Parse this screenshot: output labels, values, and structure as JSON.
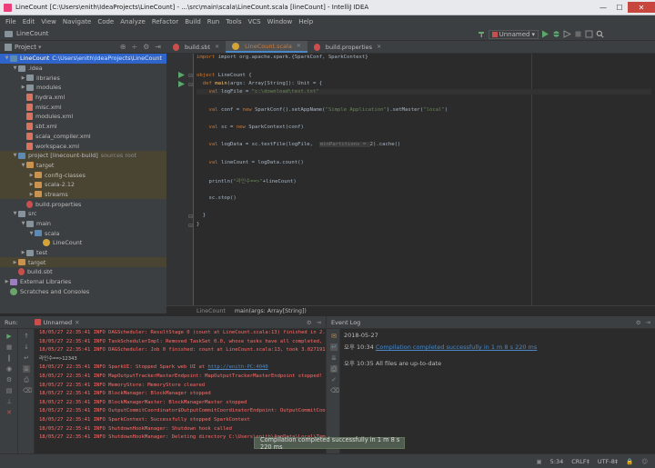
{
  "window": {
    "title": "LineCount [C:\\Users\\enith\\IdeaProjects\\LineCount] - ...\\src\\main\\scala\\LineCount.scala [lineCount] - IntelliJ IDEA",
    "min_glyph": "—",
    "max_glyph": "☐",
    "close_glyph": "✕"
  },
  "menu": [
    "File",
    "Edit",
    "View",
    "Navigate",
    "Code",
    "Analyze",
    "Refactor",
    "Build",
    "Run",
    "Tools",
    "VCS",
    "Window",
    "Help"
  ],
  "navbar": {
    "project_name": "LineCount",
    "run_config": "Unnamed"
  },
  "project_panel": {
    "title": "Project",
    "tree": [
      {
        "label": "LineCount",
        "extra": "C:\\Users\\enith\\IdeaProjects\\LineCount",
        "depth": 0,
        "arrow": "▼",
        "icon": "folder blue",
        "state": "sel"
      },
      {
        "label": ".idea",
        "extra": "",
        "depth": 1,
        "arrow": "▼",
        "icon": "folder",
        "state": ""
      },
      {
        "label": "libraries",
        "extra": "",
        "depth": 2,
        "arrow": "▶",
        "icon": "folder",
        "state": ""
      },
      {
        "label": "modules",
        "extra": "",
        "depth": 2,
        "arrow": "▶",
        "icon": "folder",
        "state": ""
      },
      {
        "label": "hydra.xml",
        "extra": "",
        "depth": 2,
        "arrow": "",
        "icon": "xmlicon",
        "state": ""
      },
      {
        "label": "misc.xml",
        "extra": "",
        "depth": 2,
        "arrow": "",
        "icon": "xmlicon",
        "state": ""
      },
      {
        "label": "modules.xml",
        "extra": "",
        "depth": 2,
        "arrow": "",
        "icon": "xmlicon",
        "state": ""
      },
      {
        "label": "sbt.xml",
        "extra": "",
        "depth": 2,
        "arrow": "",
        "icon": "xmlicon",
        "state": ""
      },
      {
        "label": "scala_compiler.xml",
        "extra": "",
        "depth": 2,
        "arrow": "",
        "icon": "xmlicon",
        "state": ""
      },
      {
        "label": "workspace.xml",
        "extra": "",
        "depth": 2,
        "arrow": "",
        "icon": "xmlicon",
        "state": ""
      },
      {
        "label": "project [linecount-build]",
        "extra": "sources root",
        "depth": 1,
        "arrow": "▼",
        "icon": "folder blue",
        "state": "hl"
      },
      {
        "label": "target",
        "extra": "",
        "depth": 2,
        "arrow": "▼",
        "icon": "folder orange",
        "state": "hl"
      },
      {
        "label": "config-classes",
        "extra": "",
        "depth": 3,
        "arrow": "▶",
        "icon": "folder orange",
        "state": "hl"
      },
      {
        "label": "scala-2.12",
        "extra": "",
        "depth": 3,
        "arrow": "▶",
        "icon": "folder orange",
        "state": "hl"
      },
      {
        "label": "streams",
        "extra": "",
        "depth": 3,
        "arrow": "▶",
        "icon": "folder orange",
        "state": "hl"
      },
      {
        "label": "build.properties",
        "extra": "",
        "depth": 2,
        "arrow": "",
        "icon": "sbticon",
        "state": ""
      },
      {
        "label": "src",
        "extra": "",
        "depth": 1,
        "arrow": "▼",
        "icon": "folder",
        "state": ""
      },
      {
        "label": "main",
        "extra": "",
        "depth": 2,
        "arrow": "▼",
        "icon": "folder",
        "state": ""
      },
      {
        "label": "scala",
        "extra": "",
        "depth": 3,
        "arrow": "▼",
        "icon": "folder blue",
        "state": ""
      },
      {
        "label": "LineCount",
        "extra": "",
        "depth": 4,
        "arrow": "",
        "icon": "scalaicon",
        "state": ""
      },
      {
        "label": "test",
        "extra": "",
        "depth": 2,
        "arrow": "▶",
        "icon": "folder",
        "state": ""
      },
      {
        "label": "target",
        "extra": "",
        "depth": 1,
        "arrow": "▶",
        "icon": "folder orange",
        "state": "hl"
      },
      {
        "label": "build.sbt",
        "extra": "",
        "depth": 1,
        "arrow": "",
        "icon": "sbticon",
        "state": ""
      },
      {
        "label": "External Libraries",
        "extra": "",
        "depth": 0,
        "arrow": "▶",
        "icon": "libicon",
        "state": ""
      },
      {
        "label": "Scratches and Consoles",
        "extra": "",
        "depth": 0,
        "arrow": "",
        "icon": "scratch",
        "state": ""
      }
    ]
  },
  "tabs": [
    {
      "label": "build.sbt",
      "active": false
    },
    {
      "label": "LineCount.scala",
      "active": true
    },
    {
      "label": "build.properties",
      "active": false
    }
  ],
  "code": {
    "l1": "import org.apache.spark.{SparkConf, SparkContext}",
    "l3a": "object ",
    "l3b": "LineCount {",
    "l4a": "  def ",
    "l4b": "main",
    "l4c": "(args: Array[String]): Unit = {",
    "l5a": "    val ",
    "l5b": "logFile = ",
    "l5c": "\"c:\\download\\test.txt\"",
    "l7a": "    val ",
    "l7b": "conf = ",
    "l7c": "new ",
    "l7d": "SparkConf().setAppName(",
    "l7e": "\"Simple Application\"",
    "l7f": ").setMaster(",
    "l7g": "\"local\"",
    "l7h": ")",
    "l9a": "    val ",
    "l9b": "sc = ",
    "l9c": "new ",
    "l9d": "SparkContext(conf)",
    "l11a": "    val ",
    "l11b": "logData = sc.textFile(logFile,  ",
    "l11c": "minPartitions = ",
    "l11d": "2).cache()",
    "l13a": "    val ",
    "l13b": "lineCount = logData.count()",
    "l15a": "    println(",
    "l15b": "\"라인수==>\"",
    "l15c": "+lineCount)",
    "l17": "    sc.stop()",
    "l19": "  }",
    "l20": "}"
  },
  "breadcrumb": {
    "object": "LineCount",
    "method": "main(args: Array[String])"
  },
  "run_panel": {
    "title": "Run:",
    "tab": "Unnamed",
    "lines": [
      {
        "text": "18/05/27 22:35:41 INFO DAGScheduler: ResultStage 0 (count at LineCount.scala:13) finished in 2.814 s",
        "kind": "err"
      },
      {
        "text": "18/05/27 22:35:41 INFO TaskSchedulerImpl: Removed TaskSet 0.0, whose tasks have all completed, from pool",
        "kind": "err"
      },
      {
        "text": "18/05/27 22:35:41 INFO DAGScheduler: Job 0 finished: count at LineCount.scala:13, took 3.027191 s",
        "kind": "err"
      },
      {
        "text": "라인수==>12343",
        "kind": "norm"
      },
      {
        "text_pre": "18/05/27 22:35:41 INFO SparkUI: Stopped Spark web UI at ",
        "link": "http://enith-PC:4040",
        "kind": "link"
      },
      {
        "text": "18/05/27 22:35:41 INFO MapOutputTrackerMasterEndpoint: MapOutputTrackerMasterEndpoint stopped!",
        "kind": "err"
      },
      {
        "text": "18/05/27 22:35:41 INFO MemoryStore: MemoryStore cleared",
        "kind": "err"
      },
      {
        "text": "18/05/27 22:35:41 INFO BlockManager: BlockManager stopped",
        "kind": "err"
      },
      {
        "text": "18/05/27 22:35:41 INFO BlockManagerMaster: BlockManagerMaster stopped",
        "kind": "err"
      },
      {
        "text": "18/05/27 22:35:41 INFO OutputCommitCoordinator$OutputCommitCoordinatorEndpoint: OutputCommitCoordinator stopped!",
        "kind": "err"
      },
      {
        "text": "18/05/27 22:35:41 INFO SparkContext: Successfully stopped SparkContext",
        "kind": "err"
      },
      {
        "text": "18/05/27 22:35:41 INFO ShutdownHookManager: Shutdown hook called",
        "kind": "err"
      },
      {
        "text": "18/05/27 22:35:41 INFO ShutdownHookManager: Deleting directory C:\\Users\\enith\\AppData\\Local\\Temp\\spark-",
        "kind": "err"
      }
    ]
  },
  "event_log": {
    "title": "Event Log",
    "date": "2018-05-27",
    "entries": [
      {
        "time": "오후 10:34",
        "text": "Compilation completed successfully in 1 m 8 s 220 ms",
        "is_link": true
      },
      {
        "time": "오후 10:35",
        "text": "All files are up-to-date",
        "is_link": false
      }
    ]
  },
  "tooltip": "Compilation completed successfully in 1 m 8 s 220 ms",
  "status": {
    "position": "5:34",
    "line_sep": "CRLF‡",
    "encoding": "UTF-8‡"
  }
}
